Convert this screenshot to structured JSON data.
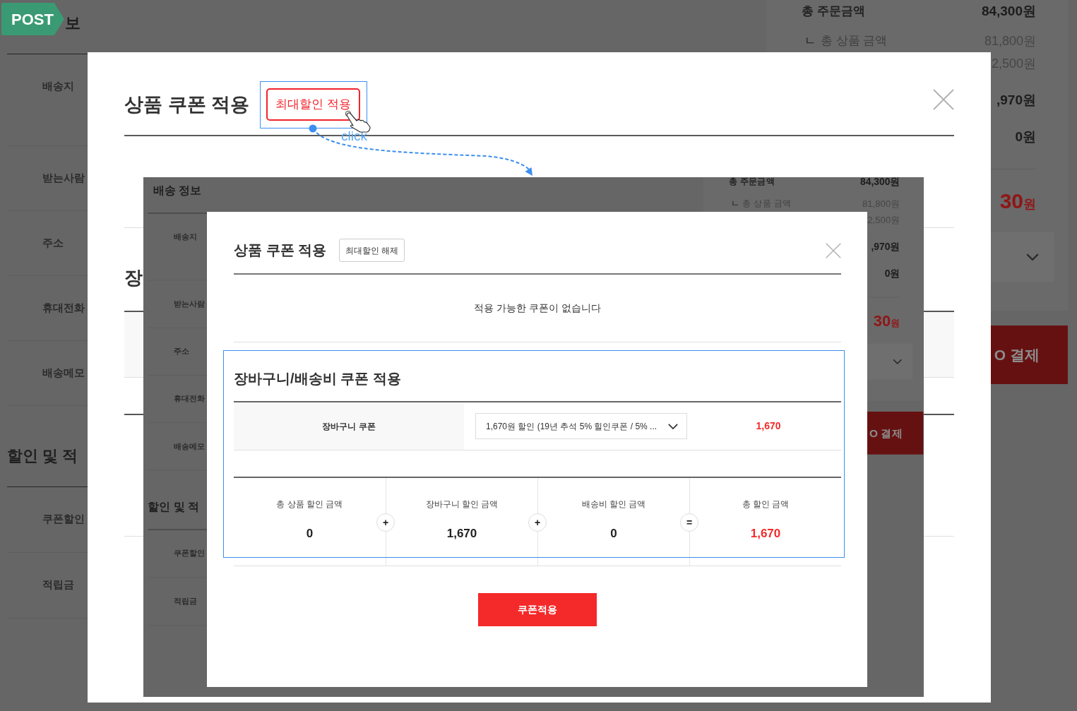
{
  "tag": {
    "label": "POST"
  },
  "page": {
    "delivery_heading": "보",
    "delivery_rows": [
      "배송지",
      "받는사람",
      "주소",
      "휴대전화",
      "배송메모"
    ],
    "discount_heading": "할인 및 적",
    "discount_rows": [
      "쿠폰할인",
      "적립금"
    ],
    "summary": {
      "rows": [
        {
          "kind": "main",
          "label": "총 주문금액",
          "value": "84,300원"
        },
        {
          "kind": "sub",
          "prefix": "ㄴ",
          "label": "총 상품 금액",
          "value": "81,800원"
        },
        {
          "kind": "sub",
          "value": "2,500원"
        },
        {
          "kind": "main",
          "value": ",970원"
        },
        {
          "kind": "main",
          "value": "0원"
        }
      ],
      "total": {
        "value": "30",
        "unit": "원"
      },
      "pay_button": "O 결제"
    }
  },
  "modal": {
    "title": "상품 쿠폰 적용",
    "max_button": {
      "kind": "apply",
      "label": "최대할인 적용"
    },
    "section_heading": "장"
  },
  "annotation": {
    "label": "click"
  },
  "inner_screenshot": {
    "page": {
      "delivery_heading": "배송 정보",
      "delivery_rows": [
        "배송지",
        "받는사람",
        "주소",
        "휴대전화",
        "배송메모"
      ],
      "discount_heading": "할인 및 적",
      "discount_rows": [
        "쿠폰할인",
        "적립금"
      ],
      "summary": {
        "rows": [
          {
            "kind": "main",
            "label": "총 주문금액",
            "value": "84,300원"
          },
          {
            "kind": "sub",
            "prefix": "ㄴ",
            "label": "총 상품 금액",
            "value": "81,800원"
          },
          {
            "kind": "sub",
            "value": "2,500원"
          },
          {
            "kind": "main",
            "value": ",970원"
          },
          {
            "kind": "main",
            "value": "0원"
          }
        ],
        "total": {
          "value": "30",
          "unit": "원"
        },
        "pay_button": "O 결제"
      }
    },
    "modal": {
      "title": "상품 쿠폰 적용",
      "max_button": {
        "kind": "release",
        "label": "최대할인 해제"
      },
      "notice": "적용 가능한 쿠폰이 없습니다",
      "section_heading": "장바구니/배송비 쿠폰 적용",
      "coupon_row": {
        "label": "장바구니 쿠폰",
        "select_value": "1,670원 할인 (19년 추석 5% 힐인쿠폰 / 5% ...",
        "amount": "1,670"
      },
      "summary": [
        {
          "label": "총 상품 할인 금액",
          "value": "0",
          "highlight": false,
          "operator": "+"
        },
        {
          "label": "장바구니 할인 금액",
          "value": "1,670",
          "highlight": false,
          "operator": "+"
        },
        {
          "label": "배송비 할인 금액",
          "value": "0",
          "highlight": false,
          "operator": "="
        },
        {
          "label": "총 할인 금액",
          "value": "1,670",
          "highlight": true
        }
      ],
      "apply_button": "쿠폰적용"
    }
  }
}
